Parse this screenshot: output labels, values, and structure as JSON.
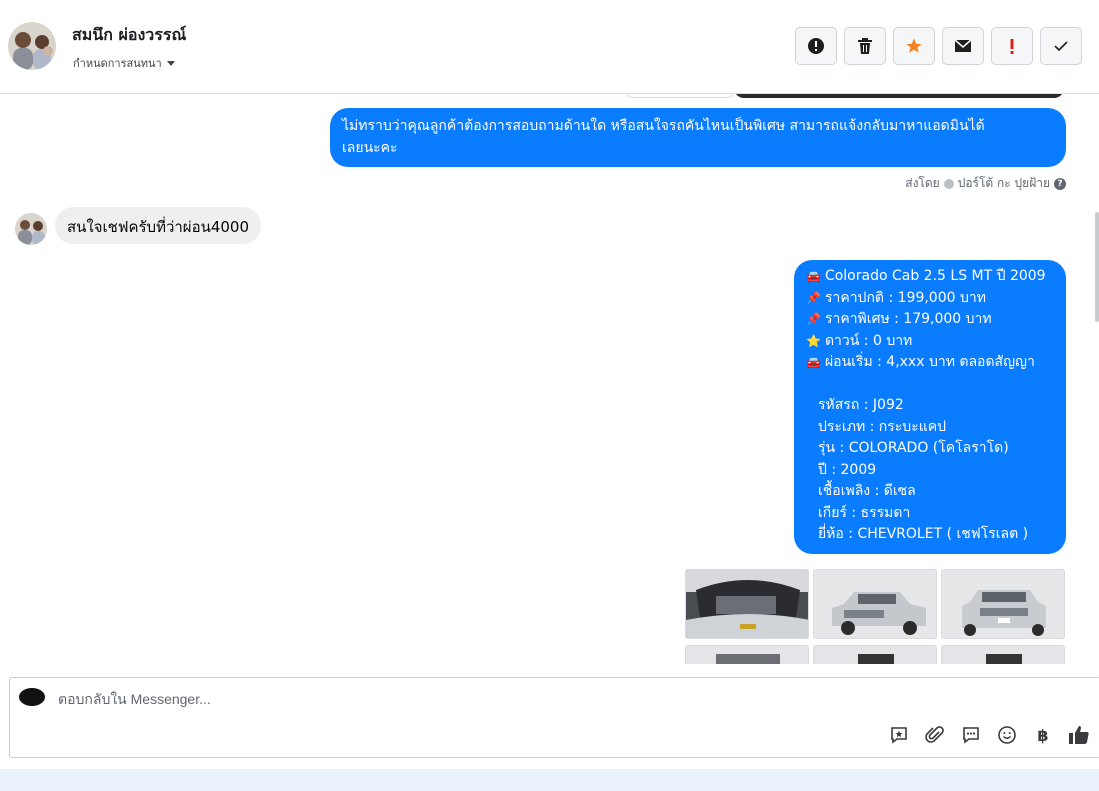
{
  "header": {
    "contact_name": "สมนึก ผ่องวรรณ์",
    "assign_label": "กำหนดการสนทนา",
    "actions": [
      {
        "name": "report-button",
        "icon": "exclamation-circle-icon"
      },
      {
        "name": "delete-button",
        "icon": "trash-icon"
      },
      {
        "name": "star-button",
        "icon": "star-icon"
      },
      {
        "name": "mark-unread-button",
        "icon": "envelope-icon"
      },
      {
        "name": "flag-button",
        "icon": "exclamation-icon"
      },
      {
        "name": "mark-done-button",
        "icon": "check-icon"
      }
    ],
    "colors": {
      "star": "#f5831f",
      "flag": "#e02020"
    }
  },
  "messages": {
    "out1": "ไม่ทราบว่าคุณลูกค้าต้องการสอบถามด้านใด หรือสนใจรถคันไหนเป็นพิเศษ สามารถแจ้งกลับมาหาแอดมินได้\nเลยนะคะ",
    "sent_by_prefix": "ส่งโดย",
    "sent_by_name": "ปอร์โต้ กะ ปุยฝ้าย",
    "in1": "สนใจเชฟครับที่ว่าผ่อน4000",
    "car_lines": [
      {
        "icon": "🚘",
        "text": "Colorado Cab 2.5 LS MT ปี 2009"
      },
      {
        "icon": "📌",
        "text": "ราคาปกติ : 199,000 บาท"
      },
      {
        "icon": "📌",
        "text": "ราคาพิเศษ : 179,000 บาท"
      },
      {
        "icon": "⭐",
        "text": "ดาวน์ : 0 บาท"
      },
      {
        "icon": "🚘",
        "text": "ผ่อนเริ่ม : 4,xxx บาท ตลอดสัญญา"
      }
    ],
    "car_details": [
      "รหัสรถ : J092",
      "ประเภท : กระบะแคป",
      "รุ่น : COLORADO (โคโลราโด)",
      "ปี : 2009",
      "เชื้อเพลิง : ดีเซล",
      "เกียร์ : ธรรมดา",
      "ยี่ห้อ : CHEVROLET ( เชฟโรเลต )"
    ],
    "bubble_color": "#0a7cff"
  },
  "photos": [
    {
      "name": "car-photo-engine"
    },
    {
      "name": "car-photo-front-left"
    },
    {
      "name": "car-photo-front"
    },
    {
      "name": "car-photo-4"
    },
    {
      "name": "car-photo-5"
    },
    {
      "name": "car-photo-6"
    }
  ],
  "composer": {
    "placeholder": "ตอบกลับใน Messenger...",
    "tools": [
      "saved-reply-icon",
      "attachment-icon",
      "quick-reply-icon",
      "emoji-icon",
      "baht-icon",
      "like-icon"
    ]
  }
}
